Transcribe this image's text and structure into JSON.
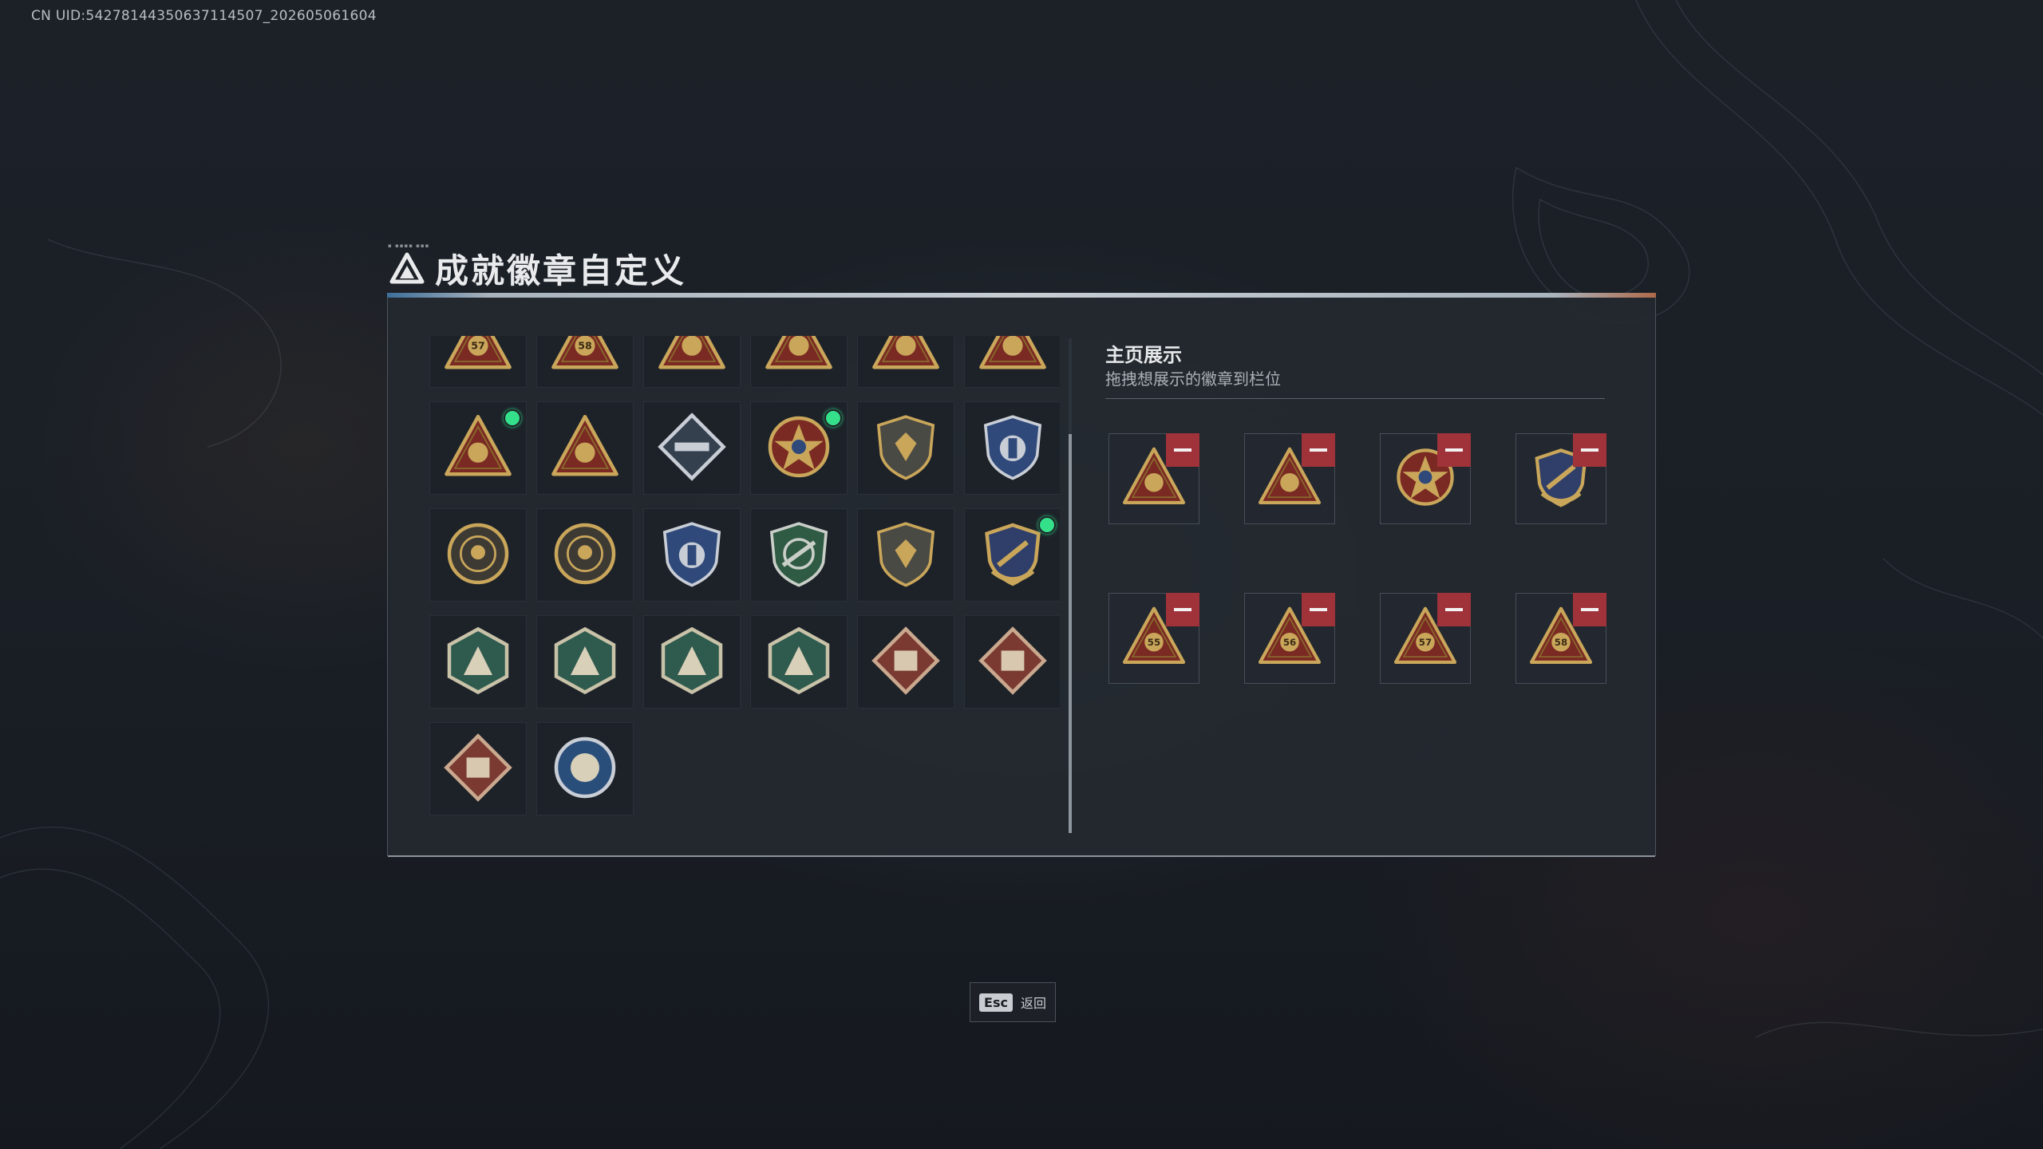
{
  "overlay": {
    "uid_text": "CN UID:54278144350637114507_202605061604"
  },
  "header": {
    "title": "成就徽章自定义",
    "logo_icon": "delta-triangle-logo-icon"
  },
  "colors": {
    "accent_green": "#35e08a",
    "remove_red": "#a0323a",
    "gold": "#c9a65a",
    "badge_red": "#7a2a22"
  },
  "badge_grid": {
    "rows": [
      [
        {
          "icon": "canister-57-triangle-badge-icon",
          "new": false
        },
        {
          "icon": "box-58-triangle-badge-icon",
          "new": false
        },
        {
          "icon": "trophy-triangle-badge-icon",
          "new": false
        },
        {
          "icon": "hand-triangle-badge-icon",
          "new": false
        },
        {
          "icon": "number-one-triangle-badge-icon",
          "new": false
        },
        {
          "icon": "figure-triangle-badge-icon",
          "new": false
        }
      ],
      [
        {
          "icon": "hands-triangle-badge-icon",
          "new": true
        },
        {
          "icon": "creature-triangle-badge-icon",
          "new": false
        },
        {
          "icon": "launcher-diamond-badge-icon",
          "new": false
        },
        {
          "icon": "star-medal-badge-icon",
          "new": true
        },
        {
          "icon": "shield-plain-badge-icon",
          "new": false
        },
        {
          "icon": "blue-shield-badge-icon",
          "new": false
        }
      ],
      [
        {
          "icon": "crosshair-coin-badge-icon",
          "new": false
        },
        {
          "icon": "monkey-coin-badge-icon",
          "new": false
        },
        {
          "icon": "blue-rifle-shield-badge-icon",
          "new": false
        },
        {
          "icon": "green-rifle-shield-badge-icon",
          "new": false
        },
        {
          "icon": "bronze-rifle-shield-badge-icon",
          "new": false
        },
        {
          "icon": "gold-rifle-crest-badge-icon",
          "new": true
        }
      ],
      [
        {
          "icon": "wasp-hexagon-badge-icon",
          "new": false
        },
        {
          "icon": "wasp-hexagon-badge-2-icon",
          "new": false
        },
        {
          "icon": "gun-hexagon-badge-icon",
          "new": false
        },
        {
          "icon": "soldier-hexagon-badge-icon",
          "new": false
        },
        {
          "icon": "dragon-diamond-badge-icon",
          "new": false
        },
        {
          "icon": "vehicle-diamond-badge-icon",
          "new": false
        }
      ],
      [
        {
          "icon": "armor-diamond-badge-icon",
          "new": false
        },
        {
          "icon": "fist-circle-badge-icon",
          "new": false
        }
      ]
    ]
  },
  "showcase": {
    "title": "主页展示",
    "subtitle": "拖拽想展示的徽章到栏位",
    "slots": [
      {
        "icon": "hands-triangle-badge-icon"
      },
      {
        "icon": "trophy-triangle-badge-icon"
      },
      {
        "icon": "star-medal-badge-icon"
      },
      {
        "icon": "gold-rifle-crest-badge-icon"
      },
      {
        "icon": "bag-55-triangle-badge-icon"
      },
      {
        "icon": "vest-56-triangle-badge-icon"
      },
      {
        "icon": "canister-57-triangle-badge-icon"
      },
      {
        "icon": "box-58-triangle-badge-icon"
      }
    ],
    "slot_labels": [
      "55",
      "56",
      "57",
      "58"
    ]
  },
  "footer": {
    "esc_key": "Esc",
    "esc_label": "返回"
  }
}
